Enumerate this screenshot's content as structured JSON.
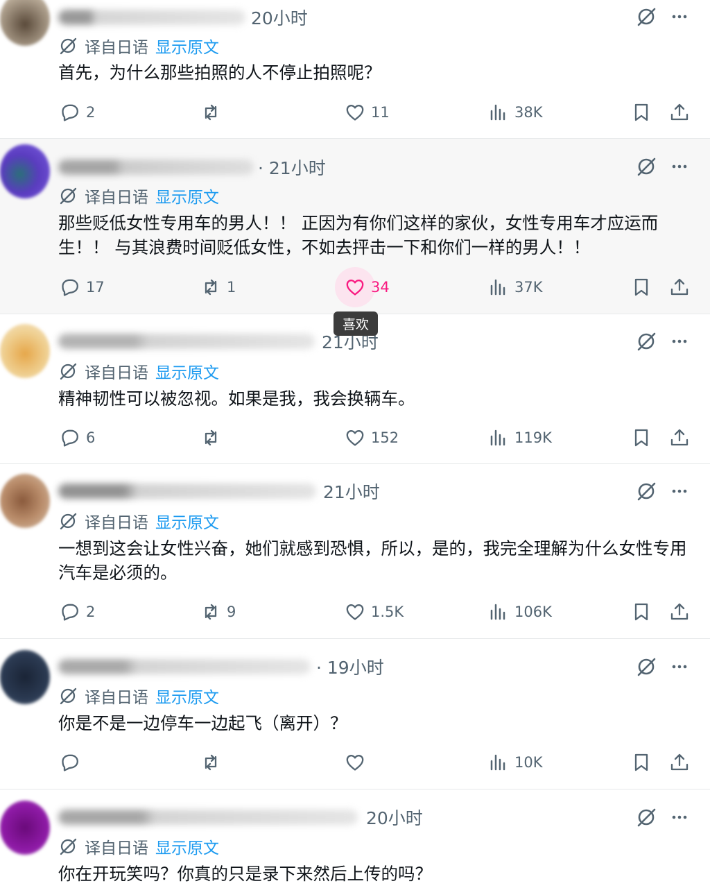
{
  "translate_label": "译自日语",
  "show_original": "显示原文",
  "tooltip": "喜欢",
  "colors": {
    "accent": "#1d9bf0",
    "like": "#f91880",
    "muted": "#536471",
    "divider": "#e7e9ea"
  },
  "posts": [
    {
      "time": "20小时",
      "text": "首先，为什么那些拍照的人不停止拍照呢？",
      "replies": "2",
      "reposts": "",
      "likes": "11",
      "views": "38K"
    },
    {
      "time": "· 21小时",
      "text": "那些贬低女性专用车的男人！！ 正因为有你们这样的家伙，女性专用车才应运而生！！ 与其浪费时间贬低女性，不如去抨击一下和你们一样的男人！！",
      "replies": "17",
      "reposts": "1",
      "likes": "34",
      "views": "37K"
    },
    {
      "time": "21小时",
      "text": "精神韧性可以被忽视。如果是我，我会换辆车。",
      "replies": "6",
      "reposts": "",
      "likes": "152",
      "views": "119K"
    },
    {
      "time": "21小时",
      "text": "一想到这会让女性兴奋，她们就感到恐惧，所以，是的，我完全理解为什么女性专用汽车是必须的。",
      "replies": "2",
      "reposts": "9",
      "likes": "1.5K",
      "views": "106K"
    },
    {
      "time": "· 19小时",
      "text": "你是不是一边停车一边起飞（离开）？",
      "replies": "",
      "reposts": "",
      "likes": "",
      "views": "10K"
    },
    {
      "time": "20小时",
      "text": "你在开玩笑吗？你真的只是录下来然后上传的吗？",
      "replies": "",
      "reposts": "",
      "likes": "",
      "views": ""
    }
  ]
}
